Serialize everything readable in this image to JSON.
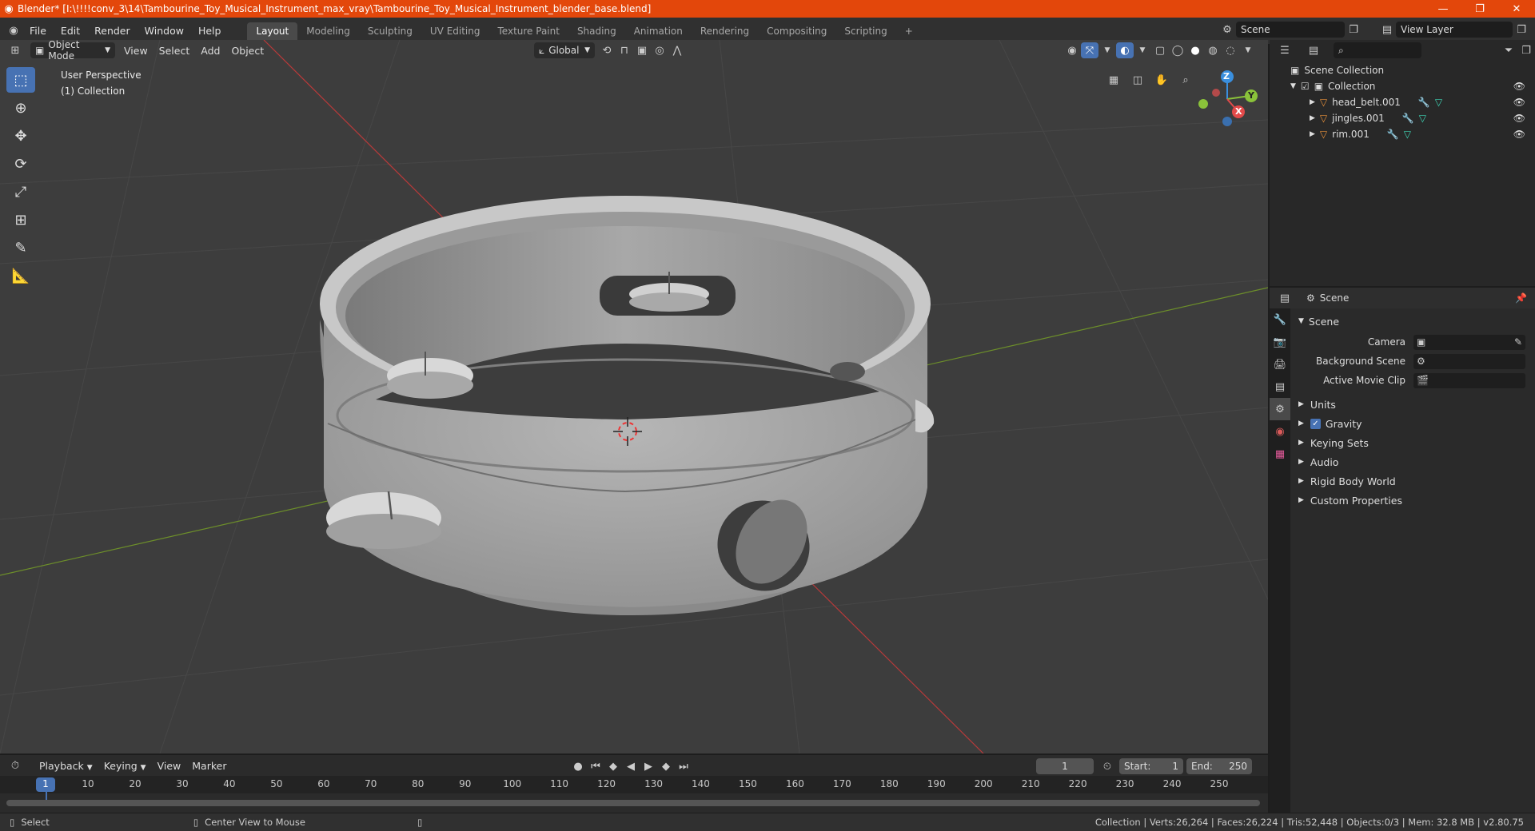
{
  "window": {
    "title": "Blender* [I:\\!!!!conv_3\\14\\Tambourine_Toy_Musical_Instrument_max_vray\\Tambourine_Toy_Musical_Instrument_blender_base.blend]",
    "minimize": "—",
    "maximize": "❐",
    "close": "✕"
  },
  "menu": [
    "File",
    "Edit",
    "Render",
    "Window",
    "Help"
  ],
  "workspaces": [
    "Layout",
    "Modeling",
    "Sculpting",
    "UV Editing",
    "Texture Paint",
    "Shading",
    "Animation",
    "Rendering",
    "Compositing",
    "Scripting"
  ],
  "add_workspace": "+",
  "scene_selector": {
    "value": "Scene"
  },
  "view_layer_selector": {
    "value": "View Layer"
  },
  "viewport": {
    "mode": "Object Mode",
    "menus": [
      "View",
      "Select",
      "Add",
      "Object"
    ],
    "orientation": "Global",
    "info_line1": "User Perspective",
    "info_line2": "(1) Collection",
    "gizmo": {
      "z": "Z",
      "y": "Y",
      "x": "X"
    }
  },
  "outliner": {
    "root": "Scene Collection",
    "collection": "Collection",
    "objects": [
      {
        "name": "head_belt.001"
      },
      {
        "name": "jingles.001"
      },
      {
        "name": "rim.001"
      }
    ]
  },
  "properties": {
    "context": "Scene",
    "panel_title": "Scene",
    "fields": [
      {
        "label": "Camera",
        "value": ""
      },
      {
        "label": "Background Scene",
        "value": ""
      },
      {
        "label": "Active Movie Clip",
        "value": ""
      }
    ],
    "sections": [
      "Units",
      "Gravity",
      "Keying Sets",
      "Audio",
      "Rigid Body World",
      "Custom Properties"
    ],
    "gravity_checked": true
  },
  "timeline": {
    "menus": [
      "Playback",
      "Keying",
      "View",
      "Marker"
    ],
    "current_frame": "1",
    "start_label": "Start:",
    "start": "1",
    "end_label": "End:",
    "end": "250",
    "ruler": [
      "1",
      "10",
      "20",
      "30",
      "40",
      "50",
      "60",
      "70",
      "80",
      "90",
      "100",
      "110",
      "120",
      "130",
      "140",
      "150",
      "160",
      "170",
      "180",
      "190",
      "200",
      "210",
      "220",
      "230",
      "240",
      "250"
    ]
  },
  "status": {
    "select": "Select",
    "center_view": "Center View to Mouse",
    "stats": "Collection | Verts:26,264 | Faces:26,224 | Tris:52,448 | Objects:0/3 | Mem: 32.8 MB | v2.80.75"
  },
  "colors": {
    "title_bar": "#e3470b",
    "accent": "#4772b3",
    "viewport_bg": "#3d3d3d",
    "object_orange": "#e8913a"
  }
}
